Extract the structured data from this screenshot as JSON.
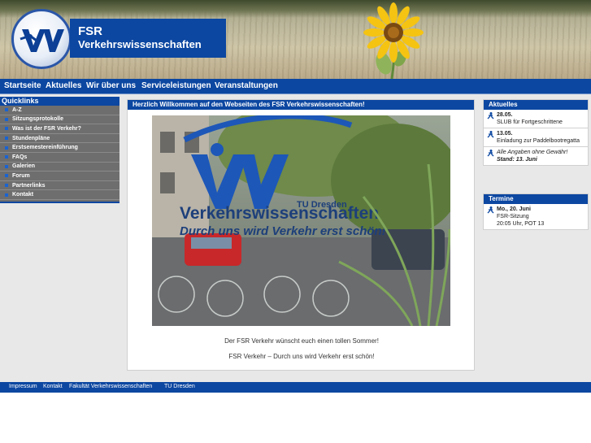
{
  "logo": {
    "line1": "FSR",
    "line2": "Verkehrswissenschaften"
  },
  "topnav": [
    "Startseite",
    "Aktuelles",
    "Wir über uns",
    "Serviceleistungen",
    "Veranstaltungen"
  ],
  "quicklinks": {
    "title": "Quicklinks",
    "items": [
      "A-Z",
      "Sitzungsprotokolle",
      "Was ist der FSR Verkehr?",
      "Stundenpläne",
      "Erstsemestereinführung",
      "FAQs",
      "Galerien",
      "Forum",
      "Partnerlinks",
      "Kontakt"
    ]
  },
  "main": {
    "title": "Herzlich Willkommen auf den Webseiten des FSR Verkehrswissenschaften!",
    "photo_text": {
      "tu": "TU Dresden",
      "name": "Verkehrswissenschaften",
      "slogan": "Durch uns wird Verkehr erst schön!"
    },
    "text1": "Der FSR Verkehr wünscht euch einen tollen Sommer!",
    "text2": "FSR Verkehr – Durch uns wird Verkehr erst schön!"
  },
  "aktuelles": {
    "title": "Aktuelles",
    "items": [
      {
        "date": "28.05.",
        "text": "SLUB für Fortgeschrittene"
      },
      {
        "date": "13.05.",
        "text": "Einladung zur Paddelbootregatta"
      }
    ],
    "disclaimer": "Alle Angaben ohne Gewähr!",
    "stand": "Stand: 13. Juni"
  },
  "termine": {
    "title": "Termine",
    "items": [
      {
        "date": "Mo., 20. Juni",
        "line2": "FSR-Sitzung",
        "line3": "20:05 Uhr, POT 13"
      }
    ]
  },
  "footer": [
    "Impressum",
    "Kontakt",
    "Fakultät Verkehrswissenschaften",
    "TU Dresden"
  ],
  "colors": {
    "brand_blue": "#0c47a1",
    "quicklinks_bg": "#6e6e6e",
    "content_bg": "#e8e8e8"
  }
}
